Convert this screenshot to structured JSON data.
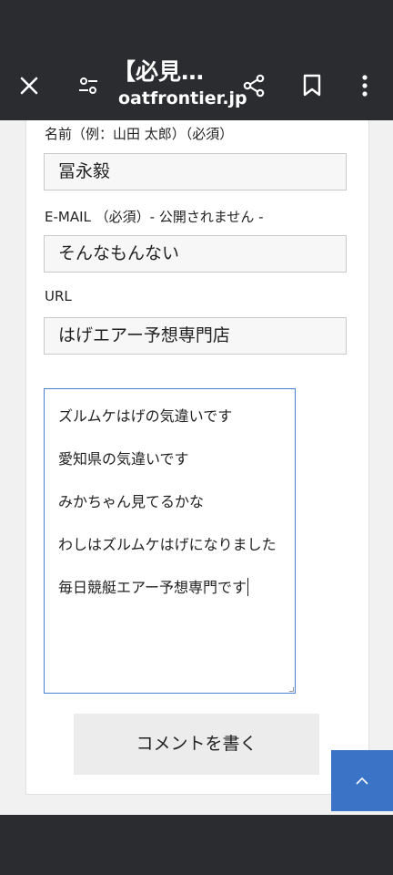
{
  "toolbar": {
    "title": "【必見…",
    "domain": "oatfrontier.jp",
    "icons": [
      "close-icon",
      "tune-icon",
      "share-icon",
      "bookmark-icon",
      "more-vert-icon"
    ]
  },
  "form": {
    "name_label": "名前（例：山田 太郎）（必須）",
    "name_value": "冨永毅",
    "email_label": "E-MAIL （必須）- 公開されません -",
    "email_value": "そんなもんない",
    "url_label": "URL",
    "url_value": "はげエアー予想専門店",
    "comment_lines": [
      "ズルムケはげの気違いです",
      "愛知県の気違いです",
      "みかちゃん見てるかな",
      "わしはズルムケはげになりました",
      "毎日競艇エアー予想専門です"
    ],
    "submit_label": "コメントを書く"
  },
  "colors": {
    "toolbar_bg": "#2b2c30",
    "accent": "#3b74c7",
    "focus_border": "#4a7fd4"
  }
}
